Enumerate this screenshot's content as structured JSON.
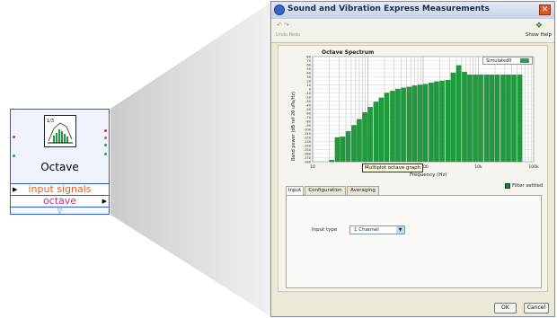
{
  "node": {
    "title": "Octave",
    "terminals": [
      "input signals",
      "octave"
    ],
    "footer_glyph": "▽"
  },
  "dialog": {
    "title": "Sound and Vibration Express Measurements",
    "close_glyph": "✕",
    "toolbar": {
      "undo_icons": "↶  ↷",
      "undo_redo_label": "Undo  Redo",
      "help_icon": "❖",
      "help_label": "Show Help"
    },
    "tooltip": "Multiplot octave graph",
    "filter_label": "Filter settled",
    "tabs": [
      "Input",
      "Configuration",
      "Averaging"
    ],
    "active_tab": "Input",
    "input_type_label": "Input type",
    "input_type_value": "1 Channel",
    "buttons": {
      "ok": "OK",
      "cancel": "Cancel"
    }
  },
  "chart_data": {
    "type": "bar",
    "title": "Octave Spectrum",
    "xlabel": "Frequency (Hz)",
    "ylabel": "Band power (dB ref 20 uPa/Hz)",
    "x_scale": "log",
    "xlim": [
      10,
      100000
    ],
    "ylim": [
      -180,
      80
    ],
    "yticks": [
      -180,
      -170,
      -160,
      -150,
      -140,
      -130,
      -120,
      -110,
      -100,
      -90,
      -80,
      -70,
      -60,
      -50,
      -40,
      -30,
      -20,
      -10,
      0,
      10,
      20,
      30,
      40,
      50,
      60,
      70,
      80
    ],
    "xticks": [
      {
        "value": 10,
        "label": "10"
      },
      {
        "value": 100,
        "label": "100"
      },
      {
        "value": 1000,
        "label": "1000"
      },
      {
        "value": 10000,
        "label": "10k"
      },
      {
        "value": 100000,
        "label": "100k"
      }
    ],
    "series": [
      {
        "name": "Simulated0",
        "color": "#1f9a3c",
        "values": [
          [
            22,
            -176
          ],
          [
            28,
            -120
          ],
          [
            35,
            -118
          ],
          [
            44,
            -105
          ],
          [
            56,
            -90
          ],
          [
            70,
            -75
          ],
          [
            88,
            -58
          ],
          [
            110,
            -45
          ],
          [
            140,
            -32
          ],
          [
            175,
            -22
          ],
          [
            220,
            -10
          ],
          [
            280,
            -5
          ],
          [
            350,
            0
          ],
          [
            440,
            3
          ],
          [
            560,
            5
          ],
          [
            700,
            8
          ],
          [
            880,
            10
          ],
          [
            1100,
            12
          ],
          [
            1400,
            15
          ],
          [
            1750,
            18
          ],
          [
            2200,
            20
          ],
          [
            2800,
            22
          ],
          [
            3500,
            40
          ],
          [
            4400,
            58
          ],
          [
            5600,
            42
          ],
          [
            7000,
            35
          ],
          [
            8800,
            35
          ],
          [
            11000,
            35
          ],
          [
            14000,
            35
          ],
          [
            17500,
            35
          ],
          [
            22000,
            35
          ],
          [
            28000,
            35
          ],
          [
            35000,
            35
          ],
          [
            44000,
            35
          ],
          [
            56000,
            35
          ]
        ]
      }
    ],
    "legend": "top-right",
    "grid": true
  }
}
